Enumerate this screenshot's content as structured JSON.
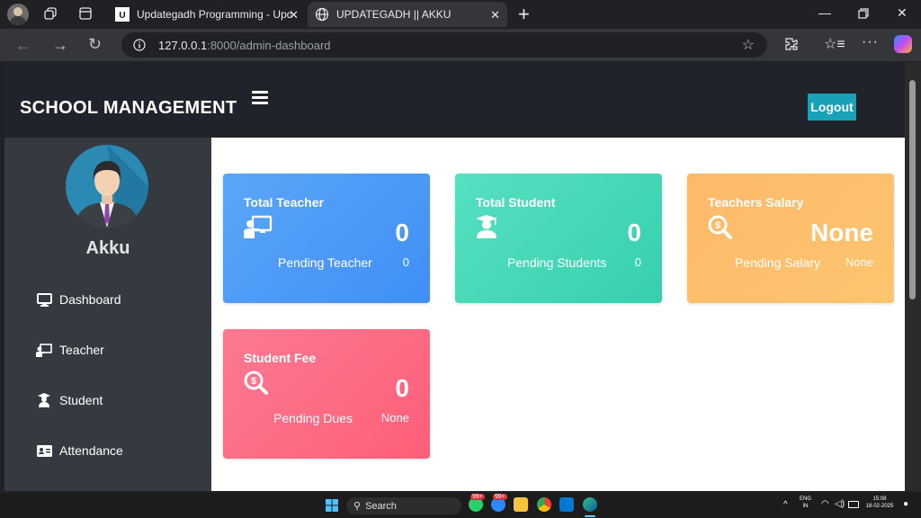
{
  "browser": {
    "tabs": [
      {
        "label": "Updategadh Programming - Upd",
        "favicon": "updategadh-logo-icon"
      },
      {
        "label": "UPDATEGADH || AKKU",
        "favicon": "globe-icon"
      }
    ],
    "new_tab_symbol": "+",
    "url_host": "127.0.0.1",
    "url_path": ":8000/admin-dashboard"
  },
  "header": {
    "brand": "SCHOOL MANAGEMENT",
    "logout_label": "Logout"
  },
  "sidebar": {
    "username": "Akku",
    "items": [
      {
        "label": "Dashboard",
        "icon": "desktop-icon"
      },
      {
        "label": "Teacher",
        "icon": "chalkboard-teacher-icon"
      },
      {
        "label": "Student",
        "icon": "graduate-icon"
      },
      {
        "label": "Attendance",
        "icon": "id-card-icon"
      }
    ]
  },
  "cards": [
    {
      "title": "Total Teacher",
      "value": "0",
      "pending_label": "Pending Teacher",
      "pending_value": "0",
      "color": "#4d9bf7",
      "icon": "chalkboard-teacher-icon"
    },
    {
      "title": "Total Student",
      "value": "0",
      "pending_label": "Pending Students",
      "pending_value": "0",
      "color": "#45d8b8",
      "icon": "graduate-icon"
    },
    {
      "title": "Teachers Salary",
      "value": "None",
      "pending_label": "Pending Salary",
      "pending_value": "None",
      "color": "#febe6c",
      "icon": "search-dollar-icon"
    },
    {
      "title": "Student Fee",
      "value": "0",
      "pending_label": "Pending Dues",
      "pending_value": "None",
      "color": "#fd6b85",
      "icon": "search-dollar-icon"
    }
  ],
  "taskbar": {
    "search_label": "Search",
    "badge_1": "99+",
    "badge_2": "99+",
    "lang_top": "ENG",
    "lang_bottom": "IN",
    "time": "15:08",
    "date": "18-02-2025"
  }
}
